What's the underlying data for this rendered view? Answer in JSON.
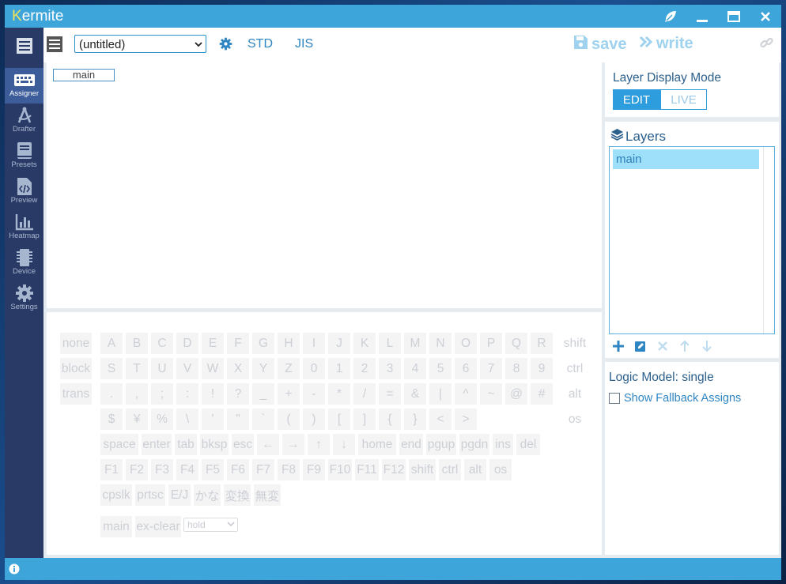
{
  "app": {
    "title_first_letter": "K",
    "title_rest": "ermite"
  },
  "window_controls": [
    "feather-icon",
    "minimize-icon",
    "maximize-icon",
    "close-icon"
  ],
  "sidebar": {
    "items": [
      {
        "label": "Assigner",
        "icon": "keyboard-icon",
        "active": true
      },
      {
        "label": "Drafter",
        "icon": "compass-icon",
        "active": false
      },
      {
        "label": "Presets",
        "icon": "book-icon",
        "active": false
      },
      {
        "label": "Preview",
        "icon": "code-file-icon",
        "active": false
      },
      {
        "label": "Heatmap",
        "icon": "bar-chart-icon",
        "active": false
      },
      {
        "label": "Device",
        "icon": "chip-icon",
        "active": false
      },
      {
        "label": "Settings",
        "icon": "gear-icon",
        "active": false
      }
    ]
  },
  "toolbar": {
    "profile_select": "(untitled)",
    "std_label": "STD",
    "jis_label": "JIS",
    "save_label": "save",
    "write_label": "write"
  },
  "key_area": {
    "layer_tab": "main"
  },
  "assign_rows": [
    [
      "none",
      "A",
      "B",
      "C",
      "D",
      "E",
      "F",
      "G",
      "H",
      "I",
      "J",
      "K",
      "L",
      "M",
      "N",
      "O",
      "P",
      "Q",
      "R"
    ],
    [
      "block",
      "S",
      "T",
      "U",
      "V",
      "W",
      "X",
      "Y",
      "Z",
      "0",
      "1",
      "2",
      "3",
      "4",
      "5",
      "6",
      "7",
      "8",
      "9"
    ],
    [
      "trans",
      ".",
      ",",
      ";",
      ":",
      "!",
      "?",
      "_",
      "+",
      "-",
      "*",
      "/",
      "=",
      "&",
      "|",
      "^",
      "~",
      "@",
      "#"
    ],
    [
      "$",
      "¥",
      "%",
      "\\",
      "'",
      "\"",
      "`",
      "(",
      ")",
      "[",
      "]",
      "{",
      "}",
      "<",
      ">"
    ],
    [
      "space",
      "enter",
      "tab",
      "bksp",
      "esc",
      "←",
      "→",
      "↑",
      "↓",
      "home",
      "end",
      "pgup",
      "pgdn",
      "ins",
      "del"
    ],
    [
      "F1",
      "F2",
      "F3",
      "F4",
      "F5",
      "F6",
      "F7",
      "F8",
      "F9",
      "F10",
      "F11",
      "F12",
      "shift",
      "ctrl",
      "alt",
      "os"
    ],
    [
      "cpslk",
      "prtsc",
      "E/J",
      "かな",
      "変換",
      "無変"
    ],
    [
      "main",
      "ex-clear"
    ]
  ],
  "modifier_keys": [
    "shift",
    "ctrl",
    "alt",
    "os"
  ],
  "hold_select": "hold",
  "layer_display": {
    "title": "Layer Display Mode",
    "edit_label": "EDIT",
    "live_label": "LIVE",
    "selected": "EDIT"
  },
  "layers": {
    "title": "Layers",
    "items": [
      "main"
    ],
    "selected": "main"
  },
  "logic": {
    "title": "Logic Model: single",
    "fallback_label": "Show Fallback Assigns",
    "fallback_checked": false
  },
  "colors": {
    "accent": "#3da5da",
    "sidebar": "#2a3a66",
    "selected_layer": "#9ee0fa"
  }
}
